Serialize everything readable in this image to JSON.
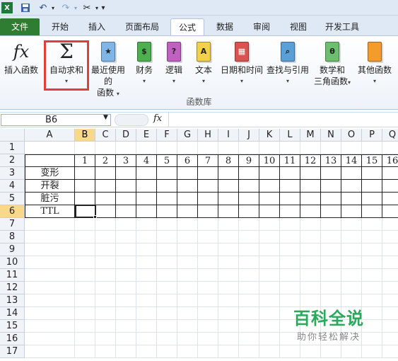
{
  "quick_access": {
    "save_icon": "save-icon",
    "undo_icon": "undo-icon",
    "redo_icon": "redo-icon",
    "tools_icon": "tools-icon",
    "customize": "▾"
  },
  "tabs": {
    "file": "文件",
    "home": "开始",
    "insert": "插入",
    "page_layout": "页面布局",
    "formulas": "公式",
    "data": "数据",
    "review": "审阅",
    "view": "视图",
    "developer": "开发工具"
  },
  "ribbon": {
    "insert_function": "插入函数",
    "autosum": "自动求和",
    "recently_used_1": "最近使用的",
    "recently_used_2": "函数",
    "financial": "财务",
    "logical": "逻辑",
    "text": "文本",
    "datetime": "日期和时间",
    "lookup": "查找与引用",
    "math_1": "数学和",
    "math_2": "三角函数",
    "other": "其他函数",
    "group_label": "函数库",
    "colors": {
      "financial": "#4caf50",
      "logical": "#c060c0",
      "text": "#f2d14a",
      "datetime": "#d9534f",
      "lookup": "#5aa0d8",
      "math": "#6cbf6c",
      "other": "#f39c2b"
    }
  },
  "formula_bar": {
    "name_box": "B6",
    "fx": "fx",
    "formula": ""
  },
  "grid": {
    "columns": [
      "A",
      "B",
      "C",
      "D",
      "E",
      "F",
      "G",
      "H",
      "I",
      "J",
      "K",
      "L",
      "M",
      "N",
      "O",
      "P",
      "Q"
    ],
    "rows": [
      "1",
      "2",
      "3",
      "4",
      "5",
      "6",
      "7",
      "8",
      "9",
      "10",
      "11",
      "12",
      "13",
      "14",
      "15",
      "16",
      "17"
    ],
    "selected_cell": "B6",
    "header_row_values": [
      "1",
      "2",
      "3",
      "4",
      "5",
      "6",
      "7",
      "8",
      "9",
      "10",
      "11",
      "12",
      "13",
      "14",
      "15",
      "16"
    ],
    "row_labels": [
      "变形",
      "开裂",
      "脏污",
      "TTL"
    ]
  },
  "watermark": {
    "title": "百科全说",
    "subtitle": "助你轻松解决"
  }
}
